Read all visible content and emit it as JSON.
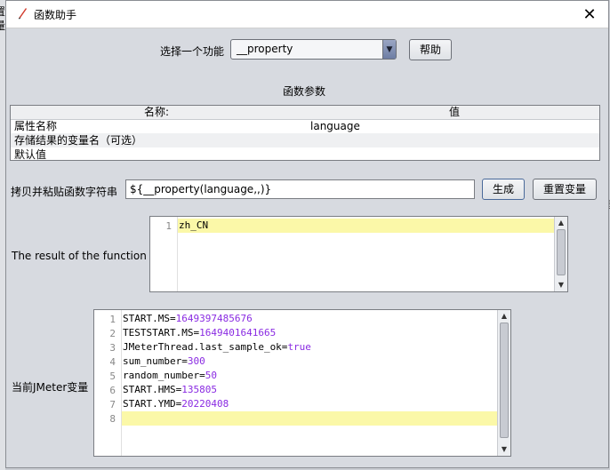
{
  "background": {
    "left_fragments": [
      "置",
      "量"
    ],
    "right_fragments": [
      "?",
      "参"
    ]
  },
  "dialog": {
    "title": "函数助手",
    "close_glyph": "✕"
  },
  "function_selector": {
    "label": "选择一个功能",
    "selected": "__property",
    "help_button": "帮助"
  },
  "params_section": {
    "title": "函数参数",
    "columns": [
      "名称:",
      "值"
    ],
    "rows": [
      {
        "name": "属性名称",
        "value": "language"
      },
      {
        "name": "存储结果的变量名（可选）",
        "value": ""
      },
      {
        "name": "默认值",
        "value": ""
      }
    ]
  },
  "copy_paste": {
    "label": "拷贝并粘贴函数字符串",
    "value": "${__property(language,,)}",
    "generate_button": "生成",
    "reset_button": "重置变量"
  },
  "result": {
    "label": "The result of the function is",
    "lines": [
      {
        "num": "1",
        "text": "zh_CN"
      }
    ]
  },
  "jmeter_vars": {
    "label": "当前JMeter变量",
    "lines": [
      {
        "num": "1",
        "key": "START.MS=",
        "val": "1649397485676"
      },
      {
        "num": "2",
        "key": "TESTSTART.MS=",
        "val": "1649401641665"
      },
      {
        "num": "3",
        "key": "JMeterThread.last_sample_ok=",
        "val": "true"
      },
      {
        "num": "4",
        "key": "sum_number=",
        "val": "300"
      },
      {
        "num": "5",
        "key": "random_number=",
        "val": "50"
      },
      {
        "num": "6",
        "key": "START.HMS=",
        "val": "135805"
      },
      {
        "num": "7",
        "key": "START.YMD=",
        "val": "20220408"
      },
      {
        "num": "8",
        "key": "",
        "val": ""
      }
    ]
  }
}
